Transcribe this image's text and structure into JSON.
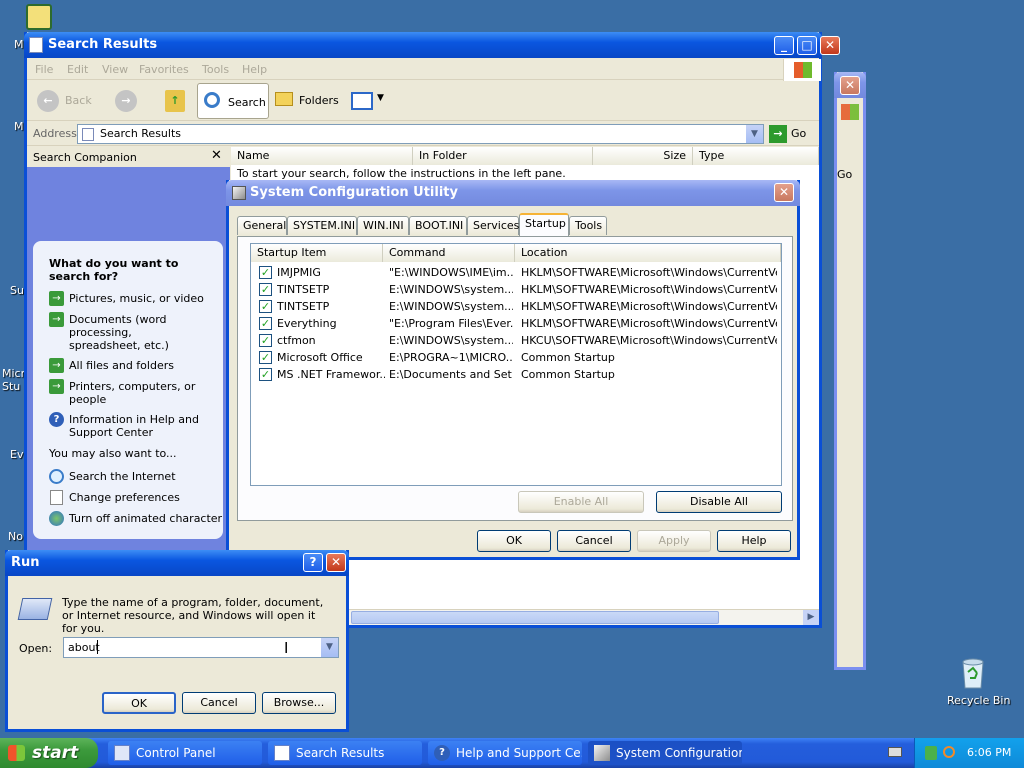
{
  "desktop": {
    "recycle_bin_label": "Recycle Bin"
  },
  "search_window": {
    "title": "Search Results",
    "menu": [
      "File",
      "Edit",
      "View",
      "Favorites",
      "Tools",
      "Help"
    ],
    "toolbar": {
      "back": "Back",
      "search": "Search",
      "folders": "Folders"
    },
    "address_label": "Address",
    "address_value": "Search Results",
    "go_label": "Go",
    "companion_title": "Search Companion",
    "question": "What do you want to search for?",
    "options": [
      "Pictures, music, or video",
      "Documents (word processing, spreadsheet, etc.)",
      "All files and folders",
      "Printers, computers, or people",
      "Information in Help and Support Center"
    ],
    "also_label": "You may also want to...",
    "also_options": [
      "Search the Internet",
      "Change preferences",
      "Turn off animated character"
    ],
    "columns": [
      "Name",
      "In Folder",
      "Size",
      "Type"
    ],
    "instruction": "To start your search, follow the instructions in the left pane."
  },
  "back_window": {
    "go_label": "Go"
  },
  "msconfig": {
    "title": "System Configuration Utility",
    "tabs": [
      "General",
      "SYSTEM.INI",
      "WIN.INI",
      "BOOT.INI",
      "Services",
      "Startup",
      "Tools"
    ],
    "active_tab": "Startup",
    "columns": [
      "Startup Item",
      "Command",
      "Location"
    ],
    "rows": [
      {
        "item": "IMJPMIG",
        "command": "\"E:\\WINDOWS\\IME\\im...",
        "location": "HKLM\\SOFTWARE\\Microsoft\\Windows\\CurrentVer...",
        "checked": true
      },
      {
        "item": "TINTSETP",
        "command": "E:\\WINDOWS\\system...",
        "location": "HKLM\\SOFTWARE\\Microsoft\\Windows\\CurrentVer...",
        "checked": true
      },
      {
        "item": "TINTSETP",
        "command": "E:\\WINDOWS\\system...",
        "location": "HKLM\\SOFTWARE\\Microsoft\\Windows\\CurrentVer...",
        "checked": true
      },
      {
        "item": "Everything",
        "command": "\"E:\\Program Files\\Ever...",
        "location": "HKLM\\SOFTWARE\\Microsoft\\Windows\\CurrentVer...",
        "checked": true
      },
      {
        "item": "ctfmon",
        "command": "E:\\WINDOWS\\system...",
        "location": "HKCU\\SOFTWARE\\Microsoft\\Windows\\CurrentVer...",
        "checked": true
      },
      {
        "item": "Microsoft Office",
        "command": "E:\\PROGRA~1\\MICRO...",
        "location": "Common Startup",
        "checked": true
      },
      {
        "item": "MS .NET Framewor...",
        "command": "E:\\Documents and Set...",
        "location": "Common Startup",
        "checked": true
      }
    ],
    "enable_all": "Enable All",
    "disable_all": "Disable All",
    "ok": "OK",
    "cancel": "Cancel",
    "apply": "Apply",
    "help": "Help"
  },
  "run": {
    "title": "Run",
    "prompt": "Type the name of a program, folder, document, or Internet resource, and Windows will open it for you.",
    "open_label": "Open:",
    "open_value": "about",
    "ok": "OK",
    "cancel": "Cancel",
    "browse": "Browse..."
  },
  "taskbar": {
    "start": "start",
    "tasks": [
      "Control Panel",
      "Search Results",
      "Help and Support Ce...",
      "System Configuration..."
    ],
    "clock": "6:06 PM"
  },
  "colors": {
    "xp_blue": "#0a4fd6",
    "desktop": "#3a6ea5",
    "start_green": "#3c9a3c"
  }
}
